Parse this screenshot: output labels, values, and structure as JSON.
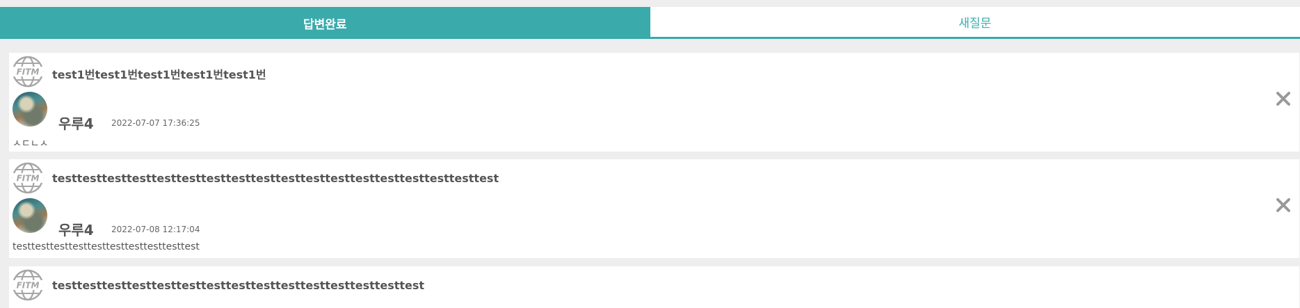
{
  "tabs": [
    {
      "label": "답변완료",
      "active": true
    },
    {
      "label": "새질문",
      "active": false
    }
  ],
  "questions": [
    {
      "title": "test1번test1번test1번test1번test1번",
      "user": "우루4",
      "date": "2022-07-07 17:36:25",
      "content": "ㅅㄷㄴㅅ"
    },
    {
      "title": "testtesttesttesttesttesttesttesttesttesttesttesttesttesttesttesttesttest",
      "user": "우루4",
      "date": "2022-07-08 12:17:04",
      "content": "testtesttesttesttesttesttesttesttesttest"
    },
    {
      "title": "testtesttesttesttesttesttesttesttesttesttesttesttesttesttest"
    }
  ],
  "icons": {
    "logo": "fitm-globe-icon",
    "delete": "close-icon"
  },
  "colors": {
    "accent": "#3aaaab",
    "text": "#555555",
    "background": "#eeeeee",
    "icon_gray": "#999999"
  }
}
